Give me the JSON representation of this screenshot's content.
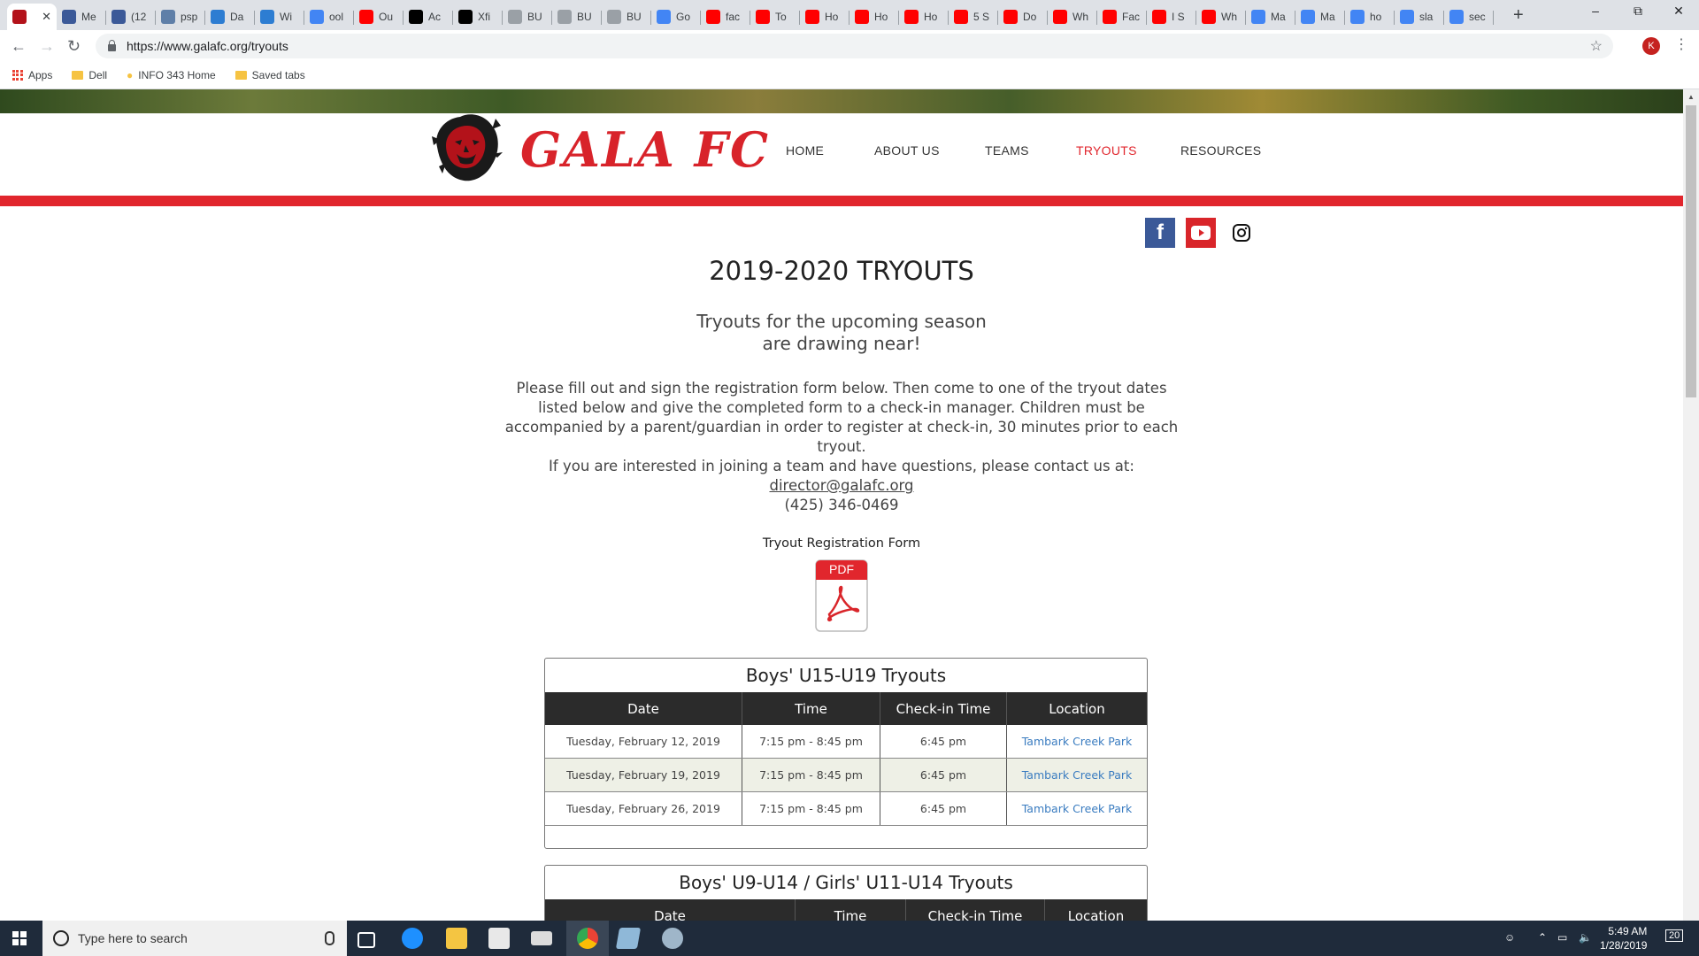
{
  "browser": {
    "tabs": [
      {
        "label": "",
        "favicon": "gala-fc-icon",
        "color": "#b3121a",
        "active": true
      },
      {
        "label": "Me",
        "favicon": "facebook-icon",
        "color": "#3b5998"
      },
      {
        "label": "(12",
        "favicon": "facebook-icon",
        "color": "#3b5998"
      },
      {
        "label": "psp",
        "favicon": "globe-icon",
        "color": "#5f7fa8"
      },
      {
        "label": "Da",
        "favicon": "x-icon",
        "color": "#2d7dd2"
      },
      {
        "label": "Wi",
        "favicon": "x-icon",
        "color": "#2d7dd2"
      },
      {
        "label": "ool",
        "favicon": "google-icon",
        "color": "#4285f4"
      },
      {
        "label": "Ou",
        "favicon": "youtube-icon",
        "color": "#ff0000"
      },
      {
        "label": "Ac",
        "favicon": "x-icon",
        "color": "#000000"
      },
      {
        "label": "Xfi",
        "favicon": "x-icon",
        "color": "#000000"
      },
      {
        "label": "BU",
        "favicon": "document-icon",
        "color": "#9aa0a6"
      },
      {
        "label": "BU",
        "favicon": "document-icon",
        "color": "#9aa0a6"
      },
      {
        "label": "BU",
        "favicon": "document-icon",
        "color": "#9aa0a6"
      },
      {
        "label": "Go",
        "favicon": "google-icon",
        "color": "#4285f4"
      },
      {
        "label": "fac",
        "favicon": "youtube-icon",
        "color": "#ff0000"
      },
      {
        "label": "To",
        "favicon": "youtube-icon",
        "color": "#ff0000"
      },
      {
        "label": "Ho",
        "favicon": "youtube-icon",
        "color": "#ff0000"
      },
      {
        "label": "Ho",
        "favicon": "youtube-icon",
        "color": "#ff0000"
      },
      {
        "label": "Ho",
        "favicon": "youtube-icon",
        "color": "#ff0000"
      },
      {
        "label": "5 S",
        "favicon": "youtube-icon",
        "color": "#ff0000"
      },
      {
        "label": "Do",
        "favicon": "youtube-icon",
        "color": "#ff0000"
      },
      {
        "label": "Wh",
        "favicon": "youtube-icon",
        "color": "#ff0000"
      },
      {
        "label": "Fac",
        "favicon": "youtube-icon",
        "color": "#ff0000"
      },
      {
        "label": "I S",
        "favicon": "youtube-icon",
        "color": "#ff0000"
      },
      {
        "label": "Wh",
        "favicon": "youtube-icon",
        "color": "#ff0000"
      },
      {
        "label": "Ma",
        "favicon": "google-icon",
        "color": "#4285f4"
      },
      {
        "label": "Ma",
        "favicon": "google-icon",
        "color": "#4285f4"
      },
      {
        "label": "ho",
        "favicon": "google-icon",
        "color": "#4285f4"
      },
      {
        "label": "sla",
        "favicon": "google-icon",
        "color": "#4285f4"
      },
      {
        "label": "sec",
        "favicon": "google-icon",
        "color": "#4285f4"
      }
    ],
    "url": "https://www.galafc.org/tryouts",
    "profile_initial": "K",
    "bookmarks": [
      "Apps",
      "Dell",
      "INFO 343 Home",
      "Saved tabs"
    ]
  },
  "site": {
    "brand": "GALA FC",
    "nav": [
      "HOME",
      "ABOUT US",
      "TEAMS",
      "TRYOUTS",
      "RESOURCES"
    ],
    "nav_active": "TRYOUTS",
    "accent": "#e1262d",
    "title": "2019-2020 TRYOUTS",
    "subtitle_line1": "Tryouts for the upcoming season",
    "subtitle_line2": "are drawing near!",
    "instructions": "Please fill out and sign the registration form below. Then come to one of the tryout dates listed below and give the completed form to a check-in manager. Children must be accompanied by a parent/guardian in order to register at check-in, 30 minutes prior to each tryout.",
    "contact_intro": "If you are interested in joining a team and have questions, please contact us at:",
    "email": "director@galafc.org",
    "phone": "(425) 346-0469",
    "form_label": "Tryout Registration Form",
    "pdf_badge": "PDF"
  },
  "tables": [
    {
      "title": "Boys' U15-U19 Tryouts",
      "headers": [
        "Date",
        "Time",
        "Check-in Time",
        "Location"
      ],
      "rows": [
        [
          "Tuesday, February 12, 2019",
          "7:15 pm - 8:45 pm",
          "6:45 pm",
          "Tambark Creek Park"
        ],
        [
          "Tuesday, February 19, 2019",
          "7:15 pm - 8:45 pm",
          "6:45 pm",
          "Tambark Creek Park"
        ],
        [
          "Tuesday, February 26, 2019",
          "7:15 pm - 8:45 pm",
          "6:45 pm",
          "Tambark Creek Park"
        ]
      ]
    },
    {
      "title": "Boys' U9-U14 / Girls' U11-U14 Tryouts",
      "headers": [
        "Date",
        "Time",
        "Check-in Time",
        "Location"
      ],
      "rows": []
    }
  ],
  "taskbar": {
    "search_placeholder": "Type here to search",
    "time": "5:49 AM",
    "date": "1/28/2019",
    "notification_count": "20"
  }
}
